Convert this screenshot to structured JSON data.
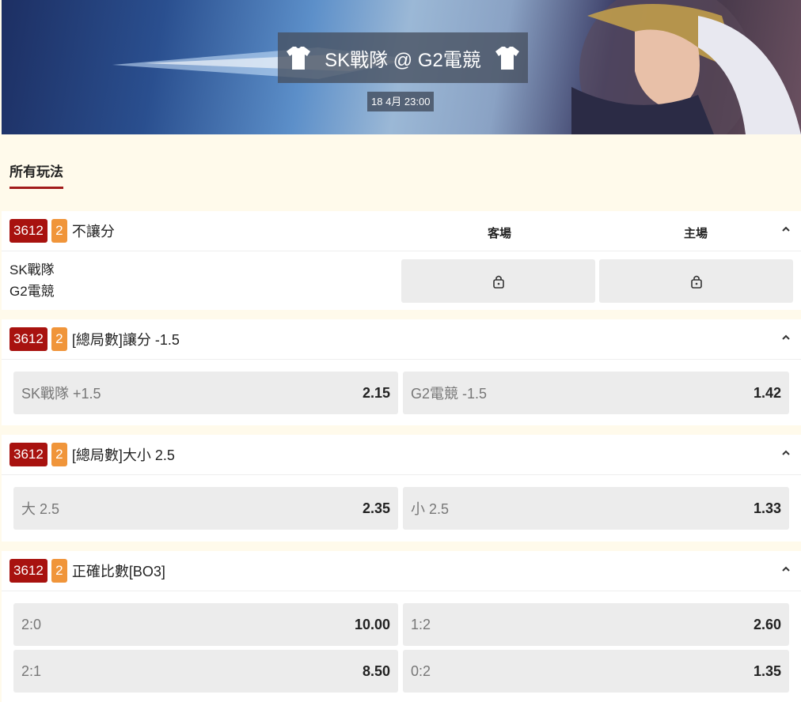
{
  "header": {
    "match_title": "SK戰隊 @ G2電競",
    "datetime": "18 4月 23:00"
  },
  "tabs": [
    {
      "label": "所有玩法",
      "active": true
    }
  ],
  "markets": [
    {
      "id": "3612",
      "count": "2",
      "title": "不讓分",
      "col_away": "客場",
      "col_home": "主場",
      "teams": [
        "SK戰隊",
        "G2電競"
      ],
      "locked": true
    },
    {
      "id": "3612",
      "count": "2",
      "title": "[總局數]讓分 -1.5",
      "selections": [
        {
          "label": "SK戰隊 +1.5",
          "price": "2.15"
        },
        {
          "label": "G2電競 -1.5",
          "price": "1.42"
        }
      ]
    },
    {
      "id": "3612",
      "count": "2",
      "title": "[總局數]大小 2.5",
      "selections": [
        {
          "label": "大 2.5",
          "price": "2.35"
        },
        {
          "label": "小 2.5",
          "price": "1.33"
        }
      ]
    },
    {
      "id": "3612",
      "count": "2",
      "title": "正確比數[BO3]",
      "selections": [
        {
          "label": "2:0",
          "price": "10.00"
        },
        {
          "label": "1:2",
          "price": "2.60"
        },
        {
          "label": "2:1",
          "price": "8.50"
        },
        {
          "label": "0:2",
          "price": "1.35"
        }
      ]
    }
  ],
  "colors": {
    "accent_red": "#a8120f",
    "badge_orange": "#f0953a",
    "page_bg": "#fffaeb",
    "cell_bg": "#ececec"
  },
  "icons": [
    "jersey-icon",
    "lock-icon",
    "chevron-up-icon"
  ]
}
